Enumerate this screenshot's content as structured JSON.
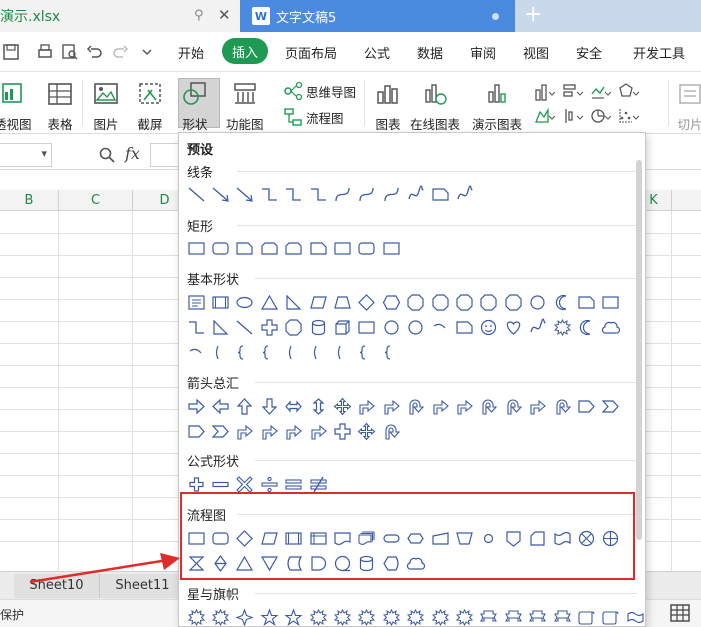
{
  "title_tabs": [
    {
      "label": "演示.xlsx",
      "color": "#1a8a43"
    },
    {
      "label": "文字文稿5",
      "color": "#ffffff"
    }
  ],
  "menu": {
    "items": [
      "开始",
      "插入",
      "页面布局",
      "公式",
      "数据",
      "审阅",
      "视图",
      "安全",
      "开发工具"
    ],
    "active": "插入",
    "active_color": "#1e9a52"
  },
  "ribbon": {
    "pivot": "透视图",
    "table": "表格",
    "picture": "图片",
    "screenshot": "截屏",
    "shape": "形状",
    "function_chart": "功能图",
    "mindmap": "思维导图",
    "flowchart": "流程图",
    "chart": "图表",
    "online_chart": "在线图表",
    "demo_chart": "演示图表",
    "slice": "切片"
  },
  "formula_bar": {
    "fx": "fx"
  },
  "columns": [
    "B",
    "C",
    "D",
    "K"
  ],
  "sheets": [
    "Sheet10",
    "Sheet11"
  ],
  "status": {
    "text": "保护"
  },
  "dropdown": {
    "preset": "预设",
    "sections": {
      "lines": "线条",
      "rect": "矩形",
      "basic": "基本形状",
      "arrows": "箭头总汇",
      "formula": "公式形状",
      "flowchart": "流程图",
      "stars": "星与旗帜"
    }
  },
  "colors": {
    "accent": "#1e9a52",
    "shape_stroke": "#3b5aa6",
    "highlight": "#e02b2b"
  }
}
